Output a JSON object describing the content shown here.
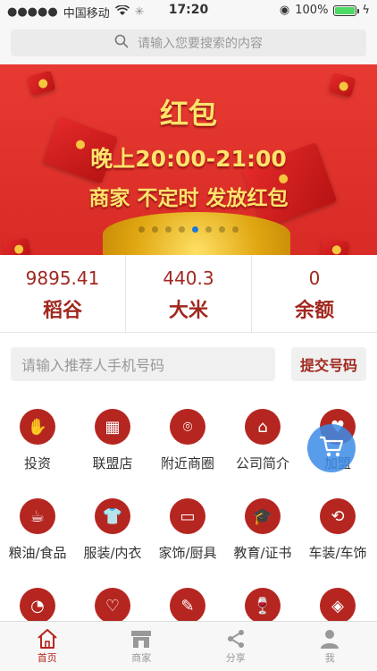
{
  "status": {
    "carrier": "中国移动",
    "time": "17:20",
    "battery": "100%"
  },
  "search": {
    "placeholder": "请输入您要搜索的内容"
  },
  "banner": {
    "title": "红包",
    "line1": "晚上20:00-21:00",
    "line2": "商家 不定时 发放红包",
    "active_dot": 4,
    "dot_count": 8
  },
  "stats": [
    {
      "value": "9895.41",
      "label": "稻谷"
    },
    {
      "value": "440.3",
      "label": "大米"
    },
    {
      "value": "0",
      "label": "余额"
    }
  ],
  "referral": {
    "placeholder": "请输入推荐人手机号码",
    "submit": "提交号码"
  },
  "grid": {
    "row1": [
      "投资",
      "联盟店",
      "附近商圈",
      "公司简介",
      "加盟"
    ],
    "row2": [
      "粮油/食品",
      "服装/内衣",
      "家饰/厨具",
      "教育/证书",
      "车装/车饰"
    ]
  },
  "tabs": [
    {
      "label": "首页",
      "icon": "home-icon"
    },
    {
      "label": "商家",
      "icon": "shop-icon"
    },
    {
      "label": "分享",
      "icon": "share-icon"
    },
    {
      "label": "我",
      "icon": "user-icon"
    }
  ],
  "colors": {
    "accent": "#b52620",
    "banner": "#e63a32",
    "float": "#3c8ce6"
  }
}
